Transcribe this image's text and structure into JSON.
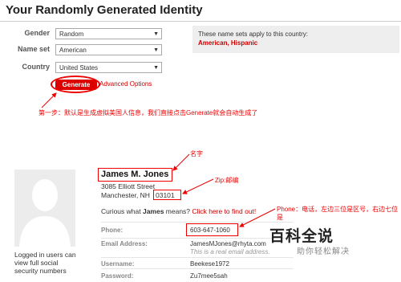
{
  "page_title": "Your Randomly Generated Identity",
  "form": {
    "gender_label": "Gender",
    "gender_value": "Random",
    "nameset_label": "Name set",
    "nameset_value": "American",
    "country_label": "Country",
    "country_value": "United States",
    "generate_label": "Generate",
    "advanced_label": "Advanced Options"
  },
  "notice": {
    "text": "These name sets apply to this country:",
    "sets": "American, Hispanic"
  },
  "annotations": {
    "step1": "第一步：默认是生成虚拟美国人信息，我们直接点击Generate就会自动生成了",
    "name": "名字",
    "zip": "Zip:邮编",
    "phone": "Phone：电话，左边三位是区号，右边七位是"
  },
  "identity": {
    "name": "James M. Jones",
    "street": "3085 Elliott Street",
    "city": "Manchester, NH",
    "zip": "03101",
    "curious_prefix": "Curious what ",
    "curious_name": "James",
    "curious_suffix": " means?",
    "curious_link": "Click here to find out!",
    "phone_label": "Phone:",
    "phone_value": "603-647-1060",
    "email_label": "Email Address:",
    "email_value": "JamesMJones@rhyta.com",
    "email_note": "This is a real email address.",
    "username_label": "Username:",
    "username_value": "Beekese1972",
    "password_label": "Password:",
    "password_value": "Zu7mee5sah"
  },
  "sidebar_note": "Logged in users can view full social security numbers",
  "watermark": {
    "title": "百科全说",
    "subtitle": "助你轻松解决"
  },
  "colors": {
    "accent": "#dd0000",
    "annotation": "#ee0000"
  }
}
